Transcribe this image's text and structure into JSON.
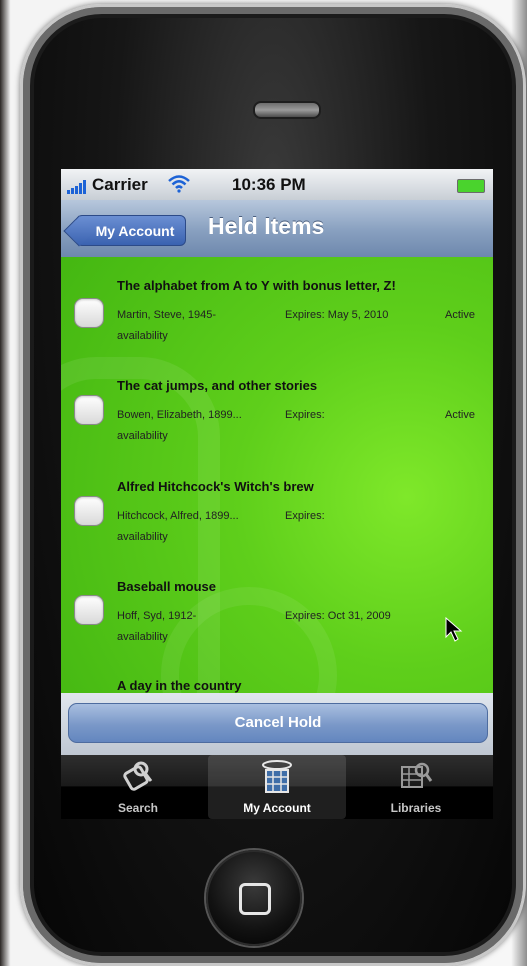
{
  "status_bar": {
    "carrier": "Carrier",
    "time": "10:36 PM"
  },
  "nav": {
    "back_label": "My Account",
    "title": "Held Items"
  },
  "items": [
    {
      "title": "The alphabet from A to Y with bonus letter, Z!",
      "author": "Martin, Steve, 1945-",
      "expires": "Expires: May 5, 2010",
      "status": "Active",
      "availability": "availability"
    },
    {
      "title": "The cat jumps, and other stories",
      "author": "Bowen, Elizabeth, 1899...",
      "expires": "Expires:",
      "status": "Active",
      "availability": "availability"
    },
    {
      "title": "Alfred Hitchcock's Witch's brew",
      "author": "Hitchcock, Alfred, 1899...",
      "expires": "Expires:",
      "status": "",
      "availability": "availability"
    },
    {
      "title": "Baseball mouse",
      "author": "Hoff, Syd, 1912-",
      "expires": "Expires: Oct 31, 2009",
      "status": "",
      "availability": "availability"
    },
    {
      "title": "A day in the country",
      "author": "",
      "expires": "",
      "status": "",
      "availability": ""
    }
  ],
  "action": {
    "cancel_label": "Cancel Hold"
  },
  "tabs": [
    {
      "label": "Search",
      "icon": "search-icon",
      "selected": false
    },
    {
      "label": "My Account",
      "icon": "account-icon",
      "selected": true
    },
    {
      "label": "Libraries",
      "icon": "libraries-icon",
      "selected": false
    }
  ],
  "colors": {
    "list_background": "#5fcf1b",
    "nav_bar": "#879fbf",
    "back_button": "#4a72c0",
    "cancel_button": "#7a98c8",
    "battery": "#4ad32d"
  }
}
